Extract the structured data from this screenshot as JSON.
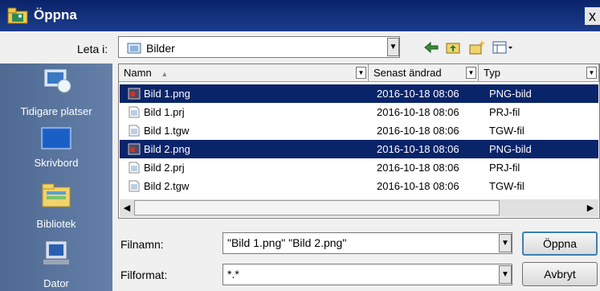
{
  "window": {
    "title": "Öppna",
    "close_glyph": "x"
  },
  "lookin": {
    "label": "Leta i:",
    "value": "Bilder",
    "dropdown_glyph": "▼"
  },
  "toolbar": {
    "icons": [
      "back-arrow-icon",
      "up-folder-icon",
      "new-folder-icon",
      "view-menu-icon"
    ]
  },
  "places": [
    {
      "label": "Tidigare platser",
      "icon": "recent-places-icon"
    },
    {
      "label": "Skrivbord",
      "icon": "desktop-icon"
    },
    {
      "label": "Bibliotek",
      "icon": "libraries-icon"
    },
    {
      "label": "Dator",
      "icon": "computer-icon"
    }
  ],
  "columns": {
    "name": "Namn",
    "sort_glyph": "▲",
    "modified": "Senast ändrad",
    "type": "Typ",
    "dropdown_glyph": "▼"
  },
  "files": [
    {
      "name": "Bild 1.png",
      "modified": "2016-10-18 08:06",
      "type": "PNG-bild",
      "selected": true,
      "icon": "png-image-icon"
    },
    {
      "name": "Bild 1.prj",
      "modified": "2016-10-18 08:06",
      "type": "PRJ-fil",
      "selected": false,
      "icon": "generic-file-icon"
    },
    {
      "name": "Bild 1.tgw",
      "modified": "2016-10-18 08:06",
      "type": "TGW-fil",
      "selected": false,
      "icon": "generic-file-icon"
    },
    {
      "name": "Bild 2.png",
      "modified": "2016-10-18 08:06",
      "type": "PNG-bild",
      "selected": true,
      "icon": "png-image-icon"
    },
    {
      "name": "Bild 2.prj",
      "modified": "2016-10-18 08:06",
      "type": "PRJ-fil",
      "selected": false,
      "icon": "generic-file-icon"
    },
    {
      "name": "Bild 2.tgw",
      "modified": "2016-10-18 08:06",
      "type": "TGW-fil",
      "selected": false,
      "icon": "generic-file-icon"
    }
  ],
  "scrollbar": {
    "left_glyph": "◀",
    "right_glyph": "▶"
  },
  "filename": {
    "label": "Filnamn:",
    "value": "\"Bild 1.png\" \"Bild 2.png\"",
    "dropdown_glyph": "▼"
  },
  "filetype": {
    "label": "Filformat:",
    "value": "*.*",
    "dropdown_glyph": "▼"
  },
  "buttons": {
    "open": "Öppna",
    "cancel": "Avbryt"
  },
  "colors": {
    "titlebar": "#0a246a",
    "selection": "#0a246a",
    "places_panel": "#5a7499"
  }
}
